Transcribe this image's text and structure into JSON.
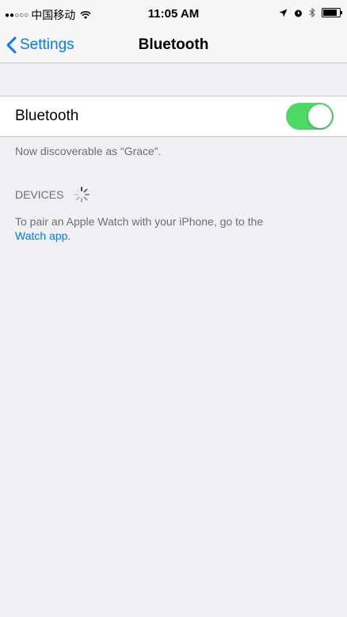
{
  "status_bar": {
    "signal": "●●○○○",
    "carrier": "中国移动",
    "time": "11:05 AM",
    "icons": [
      "wifi-icon",
      "location-icon",
      "alarm-icon",
      "bluetooth-icon",
      "battery-icon"
    ]
  },
  "nav": {
    "back_label": "Settings",
    "title": "Bluetooth"
  },
  "bluetooth_cell": {
    "label": "Bluetooth",
    "toggle_on": true,
    "toggle_color": "#4cd964"
  },
  "discoverable_text": "Now discoverable as “Grace”.",
  "devices": {
    "header": "DEVICES",
    "pair_text": "To pair an Apple Watch with your iPhone, go to the",
    "pair_link": "Watch app",
    "pair_suffix": "."
  },
  "colors": {
    "accent": "#007aff",
    "background": "#efeff4"
  }
}
